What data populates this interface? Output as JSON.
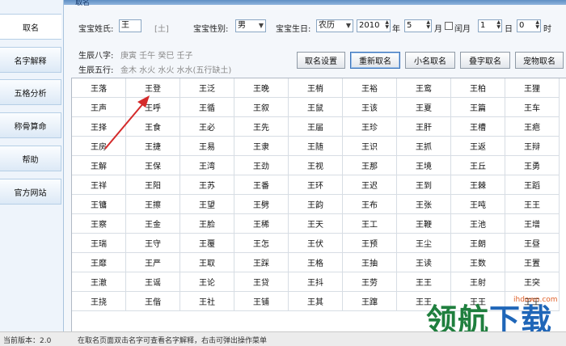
{
  "title": "取名",
  "sidebar": {
    "items": [
      {
        "label": "取名",
        "active": true
      },
      {
        "label": "名字解释"
      },
      {
        "label": "五格分析"
      },
      {
        "label": "称骨算命"
      },
      {
        "label": "帮助"
      },
      {
        "label": "官方网站"
      }
    ]
  },
  "form": {
    "surname_label": "宝宝姓氏:",
    "surname_value": "王",
    "surname_element": "[土]",
    "gender_label": "宝宝性别:",
    "gender_value": "男",
    "birth_label": "宝宝生日:",
    "calendar_value": "农历",
    "year_value": "2010",
    "year_unit": "年",
    "month_value": "5",
    "month_unit": "月",
    "leap_label": "闰月",
    "day_value": "1",
    "day_unit": "日",
    "hour_value": "0",
    "hour_unit": "时",
    "bazi_label": "生辰八字:",
    "bazi_value": "庚寅 壬午 癸巳 壬子",
    "wuxing_label": "生辰五行:",
    "wuxing_value": "金木 水火 水火 水水(五行缺土)"
  },
  "toolbar": [
    {
      "label": "取名设置"
    },
    {
      "label": "重新取名",
      "focused": true
    },
    {
      "label": "小名取名"
    },
    {
      "label": "叠字取名"
    },
    {
      "label": "宠物取名"
    }
  ],
  "names": [
    [
      "王落",
      "王登",
      "王泛",
      "王晚",
      "王梢",
      "王裕",
      "王鸾",
      "王柏",
      "王狸"
    ],
    [
      "王声",
      "王呼",
      "王循",
      "王叙",
      "王鼠",
      "王该",
      "王夏",
      "王篇",
      "王车"
    ],
    [
      "王择",
      "王食",
      "王必",
      "王先",
      "王届",
      "王珍",
      "王肝",
      "王槽",
      "王疤"
    ],
    [
      "王房",
      "王捷",
      "王易",
      "王隶",
      "王随",
      "王识",
      "王抓",
      "王返",
      "王辩"
    ],
    [
      "王解",
      "王保",
      "王湾",
      "王劲",
      "王视",
      "王那",
      "王境",
      "王丘",
      "王勇"
    ],
    [
      "王祥",
      "王阳",
      "王苏",
      "王番",
      "王环",
      "王迟",
      "王到",
      "王棘",
      "王蹈"
    ],
    [
      "王镛",
      "王擦",
      "王望",
      "王劈",
      "王韵",
      "王布",
      "王张",
      "王吨",
      "王王"
    ],
    [
      "王察",
      "王金",
      "王脸",
      "王稀",
      "王天",
      "王工",
      "王鞭",
      "王池",
      "王增"
    ],
    [
      "王瑞",
      "王守",
      "王覆",
      "王怎",
      "王伏",
      "王预",
      "王尘",
      "王朗",
      "王昼"
    ],
    [
      "王靡",
      "王严",
      "王取",
      "王踩",
      "王格",
      "王抽",
      "王读",
      "王数",
      "王置"
    ],
    [
      "王澈",
      "王谣",
      "王论",
      "王贷",
      "王抖",
      "王劳",
      "王王",
      "王射",
      "王突"
    ],
    [
      "王挠",
      "王偕",
      "王社",
      "王铺",
      "王其",
      "王蹿",
      "王王",
      "王王",
      "王王"
    ]
  ],
  "status": {
    "version": "当前版本：2.0",
    "tip": "在取名页面双击名字可查看名字解释，右击可弹出操作菜单"
  },
  "watermark": {
    "domain": "ihdown.com",
    "text_a": "领航",
    "text_b": "下载"
  },
  "colors": {
    "accent": "#5f8fc4",
    "arrow": "#d42a2a",
    "watermark_green": "#1f7f3e",
    "watermark_blue": "#1f66b8"
  },
  "icons": {
    "dropdown": "chevron-down-icon",
    "spinner": "spin-arrows-icon",
    "annotation": "red-arrow-icon"
  }
}
